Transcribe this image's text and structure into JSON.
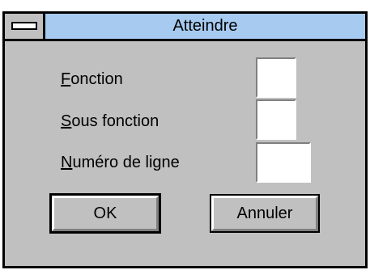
{
  "window": {
    "title": "Atteindre"
  },
  "fields": [
    {
      "mnemonic": "F",
      "rest": "onction",
      "value": ""
    },
    {
      "mnemonic": "S",
      "rest": "ous fonction",
      "value": ""
    },
    {
      "mnemonic": "N",
      "rest": "uméro de ligne",
      "value": ""
    }
  ],
  "buttons": {
    "ok": "OK",
    "cancel": "Annuler"
  }
}
